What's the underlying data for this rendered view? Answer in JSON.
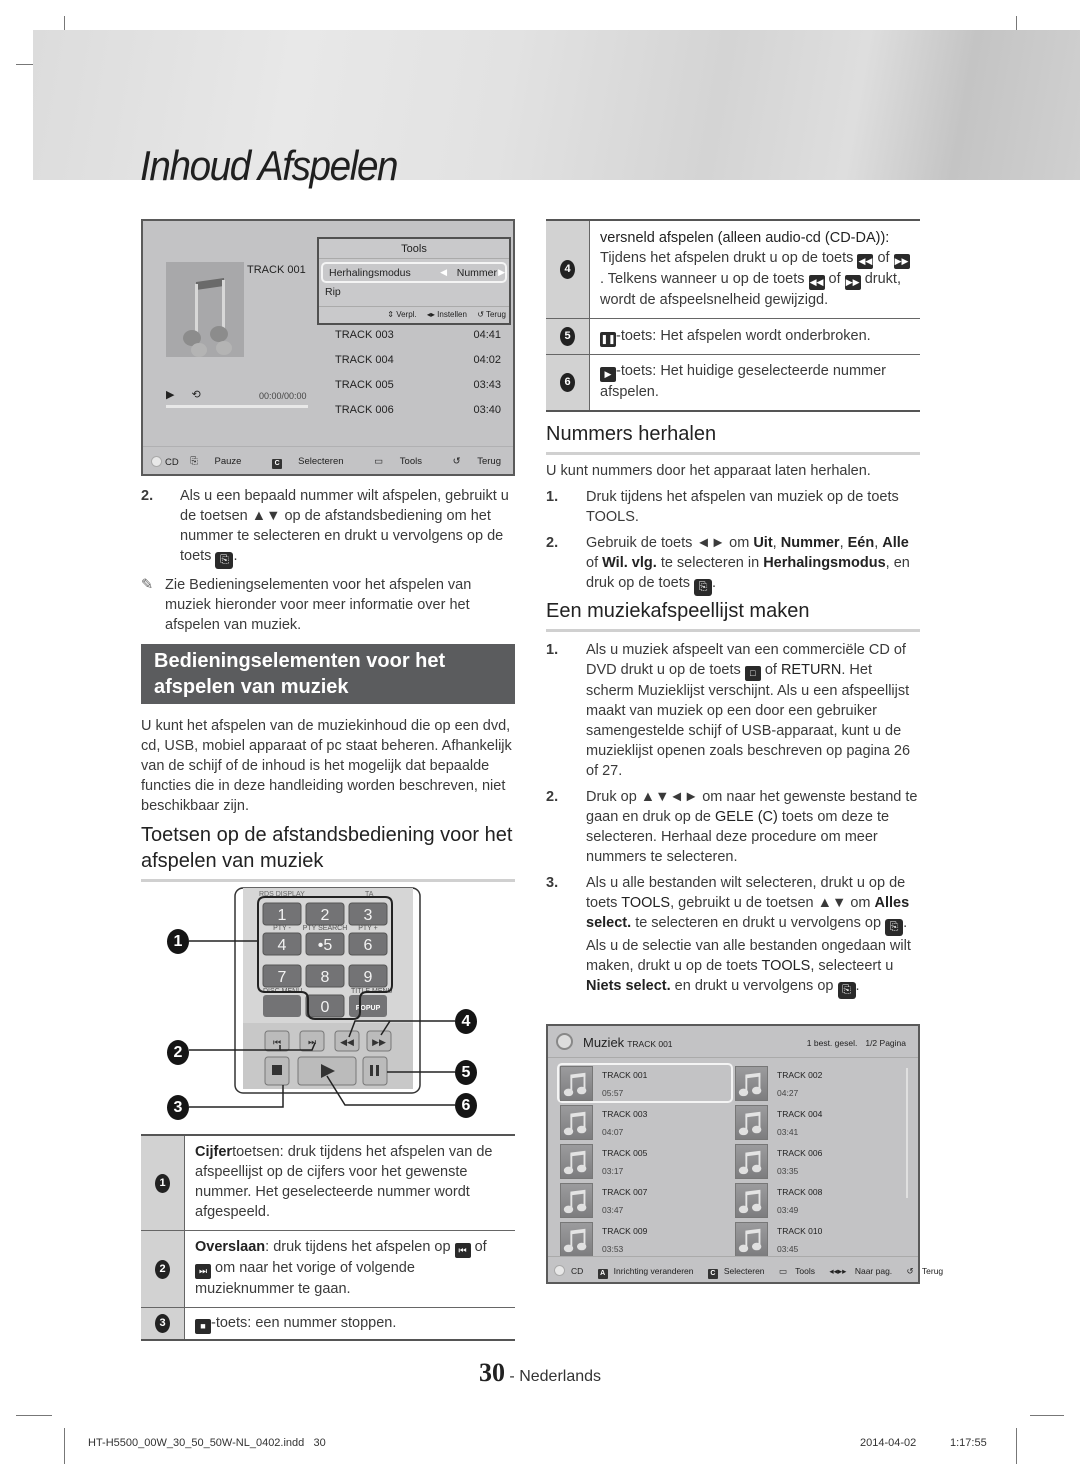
{
  "header": {
    "title": "Inhoud Afspelen"
  },
  "screen1": {
    "track_title": "TRACK 001",
    "tools": {
      "title": "Tools",
      "rows": [
        {
          "label": "Herhalingsmodus",
          "value": "Nummer",
          "selected": true
        },
        {
          "label": "Rip",
          "value": "",
          "selected": false
        }
      ],
      "footer": [
        "⇕ Verpl.",
        "◂▸ Instellen",
        "↺ Terug"
      ]
    },
    "tracks": [
      {
        "name": "TRACK 003",
        "duration": "04:41"
      },
      {
        "name": "TRACK 004",
        "duration": "04:02"
      },
      {
        "name": "TRACK 005",
        "duration": "03:43"
      },
      {
        "name": "TRACK 006",
        "duration": "03:40"
      }
    ],
    "time": "00:00/00:00",
    "progress": 0,
    "footer": {
      "source": "CD",
      "pause": "Pauze",
      "select_key": "C",
      "select": "Selecteren",
      "tools": "Tools",
      "back": "Terug"
    }
  },
  "left": {
    "step2_num": "2.",
    "step2_text": "Als u een bepaald nummer wilt afspelen, gebruikt u de toetsen ▲▼ op de afstandsbediening om het nummer te selecteren en drukt u vervolgens op de toets",
    "note_icon": "✎",
    "note_text": "Zie Bedieningselementen voor het afspelen van muziek hieronder voor meer informatie over het afspelen van muziek.",
    "section_title": "Bedieningselementen voor het afspelen van muziek",
    "intro": "U kunt het afspelen van de muziekinhoud die op een dvd, cd, USB, mobiel apparaat of pc staat beheren. Afhankelijk van de schijf of de inhoud is het mogelijk dat bepaalde functies die in deze handleiding worden beschreven, niet beschikbaar zijn.",
    "remote_heading": "Toetsen op de afstandsbediening voor het afspelen van muziek"
  },
  "remote": {
    "top_labels": [
      "RDS DISPLAY",
      "TA"
    ],
    "keys": [
      "1",
      "2",
      "3",
      "4",
      "5",
      "6",
      "7",
      "8",
      "9",
      "0"
    ],
    "sub_labels": [
      "PTY -",
      "PTY SEARCH",
      "PTY +"
    ],
    "disc_menu": "DISC MENU",
    "title_menu": "TITLE MENU",
    "popup": "POPUP",
    "callouts": [
      "1",
      "2",
      "3",
      "4",
      "5",
      "6"
    ]
  },
  "legend_left": [
    {
      "num": "1",
      "bold": "Cijfer",
      "text": "toetsen: druk tijdens het afspelen van de afspeellijst op de cijfers voor het gewenste nummer. Het geselecteerde nummer wordt afgespeeld."
    },
    {
      "num": "2",
      "bold": "Overslaan",
      "text_a": ": druk tijdens het afspelen op",
      "of": "of",
      "text_b": "om naar het vorige of volgende muzieknummer te gaan."
    },
    {
      "num": "3",
      "text": "-toets: een nummer stoppen."
    }
  ],
  "legend_right": [
    {
      "num": "4",
      "bold": "versneld afspelen (alleen audio-cd (CD-DA)):",
      "text_a": "Tijdens het afspelen drukt u op de toets",
      "of": "of",
      "text_b": ". Telkens wanneer u op de toets",
      "text_c": "drukt, wordt de afspeelsnelheid gewijzigd."
    },
    {
      "num": "5",
      "text": "-toets: Het afspelen wordt onderbroken."
    },
    {
      "num": "6",
      "text": "-toets: Het huidige geselecteerde nummer afspelen."
    }
  ],
  "repeat": {
    "heading": "Nummers herhalen",
    "intro": "U kunt nummers door het apparaat laten herhalen.",
    "step1_num": "1.",
    "step1_text": "Druk tijdens het afspelen van muziek op de toets",
    "step1_key": "TOOLS.",
    "step2_num": "2.",
    "step2_a": "Gebruik de toets ◄► om",
    "opt_uit": "Uit",
    "opt_nummer": "Nummer",
    "opt_een": "Eén",
    "opt_alle": "Alle",
    "opt_wil": "Wil. vlg.",
    "step2_b": "te selecteren in",
    "mode": "Herhalingsmodus",
    "step2_c": ", en druk op de toets"
  },
  "playlist": {
    "heading": "Een muziekafspeellijst maken",
    "step1_num": "1.",
    "step1_a": "Als u muziek afspeelt van een commerciële CD of DVD drukt u op de toets",
    "step1_of": "of",
    "step1_return": "RETURN",
    "step1_b": ". Het scherm Muzieklijst verschijnt. Als u een afspeellijst maakt van muziek op een door een gebruiker samengestelde schijf of USB-apparaat, kunt u de muzieklijst openen zoals beschreven op pagina 26 of 27.",
    "step2_num": "2.",
    "step2_a": "Druk op ▲▼◄► om naar het gewenste bestand te gaan en druk op de",
    "step2_key": "GELE (C)",
    "step2_b": "toets om deze te selecteren. Herhaal deze procedure om meer nummers te selecteren.",
    "step3_num": "3.",
    "step3_a": "Als u alle bestanden wilt selecteren, drukt u op de toets",
    "tools": "TOOLS",
    "step3_b": ", gebruikt u de toetsen ▲▼ om",
    "alles": "Alles select.",
    "step3_c": "te selecteren en drukt u vervolgens op",
    "step3_d": ". Als u de selectie van alle bestanden ongedaan wilt maken, drukt u op de toets",
    "step3_e": ", selecteert u",
    "niets": "Niets select.",
    "step3_f": "en drukt u vervolgens op"
  },
  "screen2": {
    "title": "Muziek",
    "subtitle": "TRACK 001",
    "selected_count": "1 best. gesel.",
    "page": "1/2 Pagina",
    "tracks": [
      {
        "name": "TRACK 001",
        "duration": "05:57",
        "selected": true
      },
      {
        "name": "TRACK 002",
        "duration": "04:27"
      },
      {
        "name": "TRACK 003",
        "duration": "04:07"
      },
      {
        "name": "TRACK 004",
        "duration": "03:41"
      },
      {
        "name": "TRACK 005",
        "duration": "03:17"
      },
      {
        "name": "TRACK 006",
        "duration": "03:35"
      },
      {
        "name": "TRACK 007",
        "duration": "03:47"
      },
      {
        "name": "TRACK 008",
        "duration": "03:49"
      },
      {
        "name": "TRACK 009",
        "duration": "03:53"
      },
      {
        "name": "TRACK 010",
        "duration": "03:45"
      }
    ],
    "footer": {
      "source": "CD",
      "layout_key": "A",
      "layout": "Inrichting veranderen",
      "select_key": "C",
      "select": "Selecteren",
      "tools": "Tools",
      "page": "Naar pag.",
      "back": "Terug"
    }
  },
  "footer": {
    "page_number": "30",
    "language": "- Nederlands",
    "file": "HT-H5500_00W_30_50_50W-NL_0402.indd   30",
    "date": "2014-04-02",
    "time": "1:17:55"
  },
  "colors": {
    "section_bg": "#5b5c5e",
    "tv_bg": "#c3c3c5",
    "legend_num_bg": "#d2d2d2"
  }
}
